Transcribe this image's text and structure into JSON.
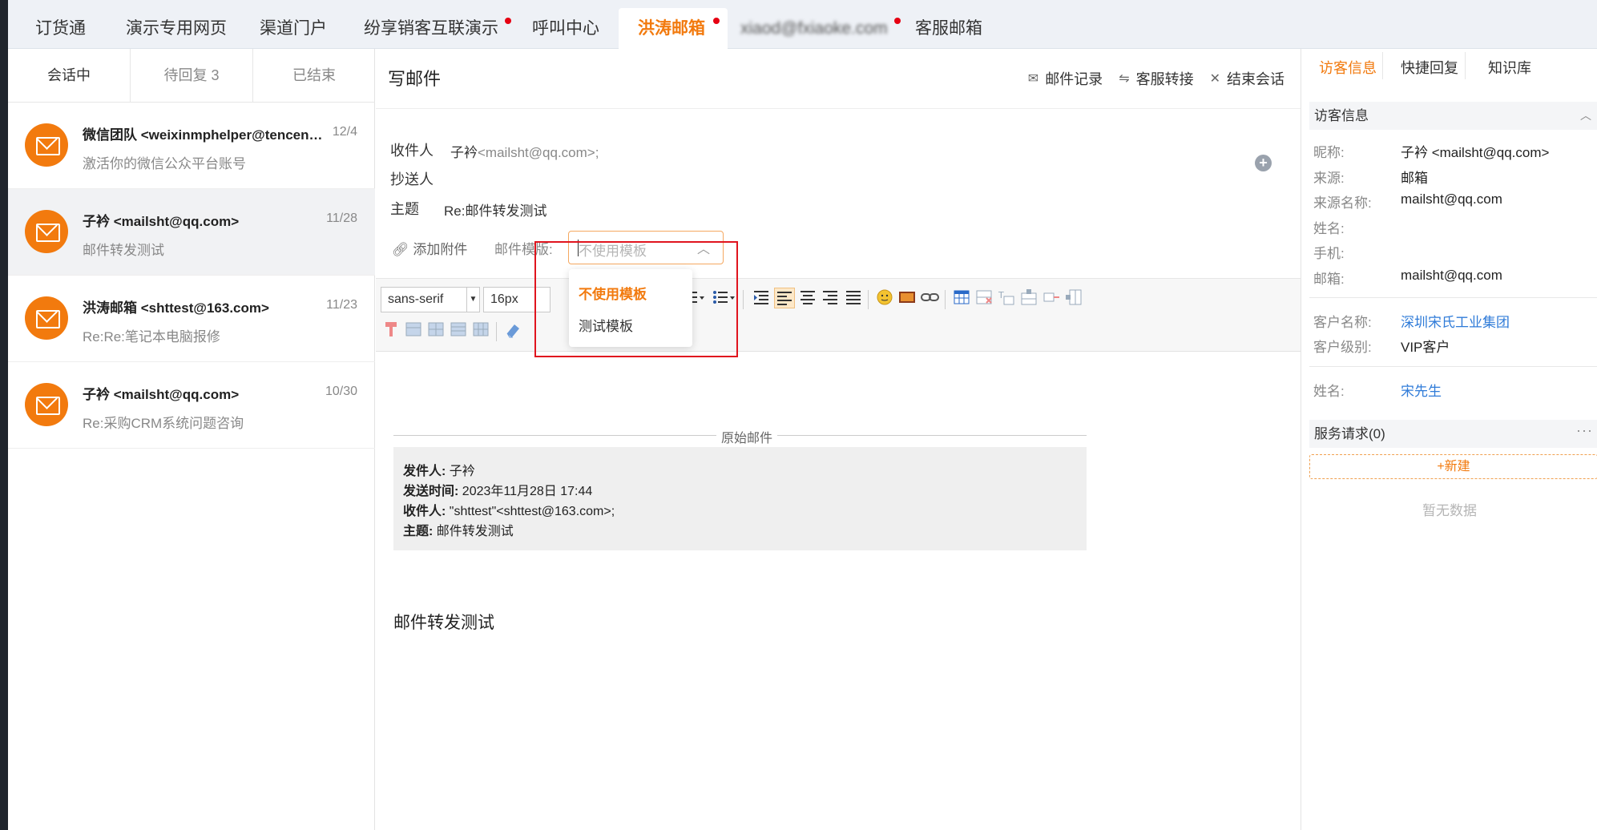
{
  "top_tabs": [
    {
      "label": "订货通",
      "dot": false
    },
    {
      "label": "演示专用网页",
      "dot": false
    },
    {
      "label": "渠道门户",
      "dot": false
    },
    {
      "label": "纷享销客互联演示",
      "dot": true
    },
    {
      "label": "呼叫中心",
      "dot": false
    },
    {
      "label": "洪涛邮箱",
      "dot": true,
      "active": true
    },
    {
      "label": "xiaod@fxiaoke.com",
      "dot": true,
      "blurred": true
    },
    {
      "label": "客服邮箱",
      "dot": false
    }
  ],
  "session_tabs": [
    "会话中",
    "待回复 3",
    "已结束"
  ],
  "sessions": [
    {
      "name": "微信团队 <weixinmphelper@tencent.com>",
      "date": "12/4",
      "subject": "激活你的微信公众平台账号"
    },
    {
      "name": "子衿 <mailsht@qq.com>",
      "date": "11/28",
      "subject": "邮件转发测试",
      "selected": true
    },
    {
      "name": "洪涛邮箱 <shttest@163.com>",
      "date": "11/23",
      "subject": "Re:Re:笔记本电脑报修"
    },
    {
      "name": "子衿 <mailsht@qq.com>",
      "date": "10/30",
      "subject": "Re:采购CRM系统问题咨询"
    }
  ],
  "compose": {
    "title": "写邮件",
    "actions": [
      {
        "icon": "envelope-icon",
        "label": "邮件记录"
      },
      {
        "icon": "transfer-icon",
        "label": "客服转接"
      },
      {
        "icon": "close-icon",
        "label": "结束会话"
      }
    ],
    "to_label": "收件人",
    "to_name": "子衿",
    "to_addr": "<mailsht@qq.com>;",
    "cc_label": "抄送人",
    "subject_label": "主题",
    "subject_value": "Re:邮件转发测试",
    "attach_label": "添加附件",
    "template_label": "邮件模版:",
    "template_placeholder": "不使用模板",
    "font_family": "sans-serif",
    "font_size": "16px",
    "template_options": [
      "不使用模板",
      "测试模板"
    ],
    "original_label": "原始邮件",
    "quote": {
      "from_label": "发件人:",
      "from_value": "子衿",
      "time_label": "发送时间:",
      "time_value": "2023年11月28日 17:44",
      "to_label": "收件人:",
      "to_value": "\"shttest\"<shttest@163.com>;",
      "subject_label": "主题:",
      "subject_value": "邮件转发测试"
    },
    "body": "邮件转发测试"
  },
  "right": {
    "tabs": [
      "访客信息",
      "快捷回复",
      "知识库"
    ],
    "visitor_header": "访客信息",
    "fields": [
      {
        "label": "昵称:",
        "value": "子衿 <mailsht@qq.com>"
      },
      {
        "label": "来源:",
        "value": "邮箱"
      },
      {
        "label": "来源名称:",
        "value": "mailsht@qq.com"
      },
      {
        "label": "姓名:",
        "value": ""
      },
      {
        "label": "手机:",
        "value": ""
      },
      {
        "label": "邮箱:",
        "value": "mailsht@qq.com"
      }
    ],
    "customer_fields": [
      {
        "label": "客户名称:",
        "value": "深圳宋氏工业集团"
      },
      {
        "label": "客户级别:",
        "value": "VIP客户"
      }
    ],
    "contact_fields": [
      {
        "label": "姓名:",
        "value": "宋先生"
      }
    ],
    "service_header": "服务请求(0)",
    "new_label": "+新建",
    "no_data": "暂无数据"
  },
  "colors": {
    "accent": "#f27a0e",
    "link": "#2f7bd8",
    "alert_dot": "#e60012",
    "highlight_box": "#e0141e"
  }
}
